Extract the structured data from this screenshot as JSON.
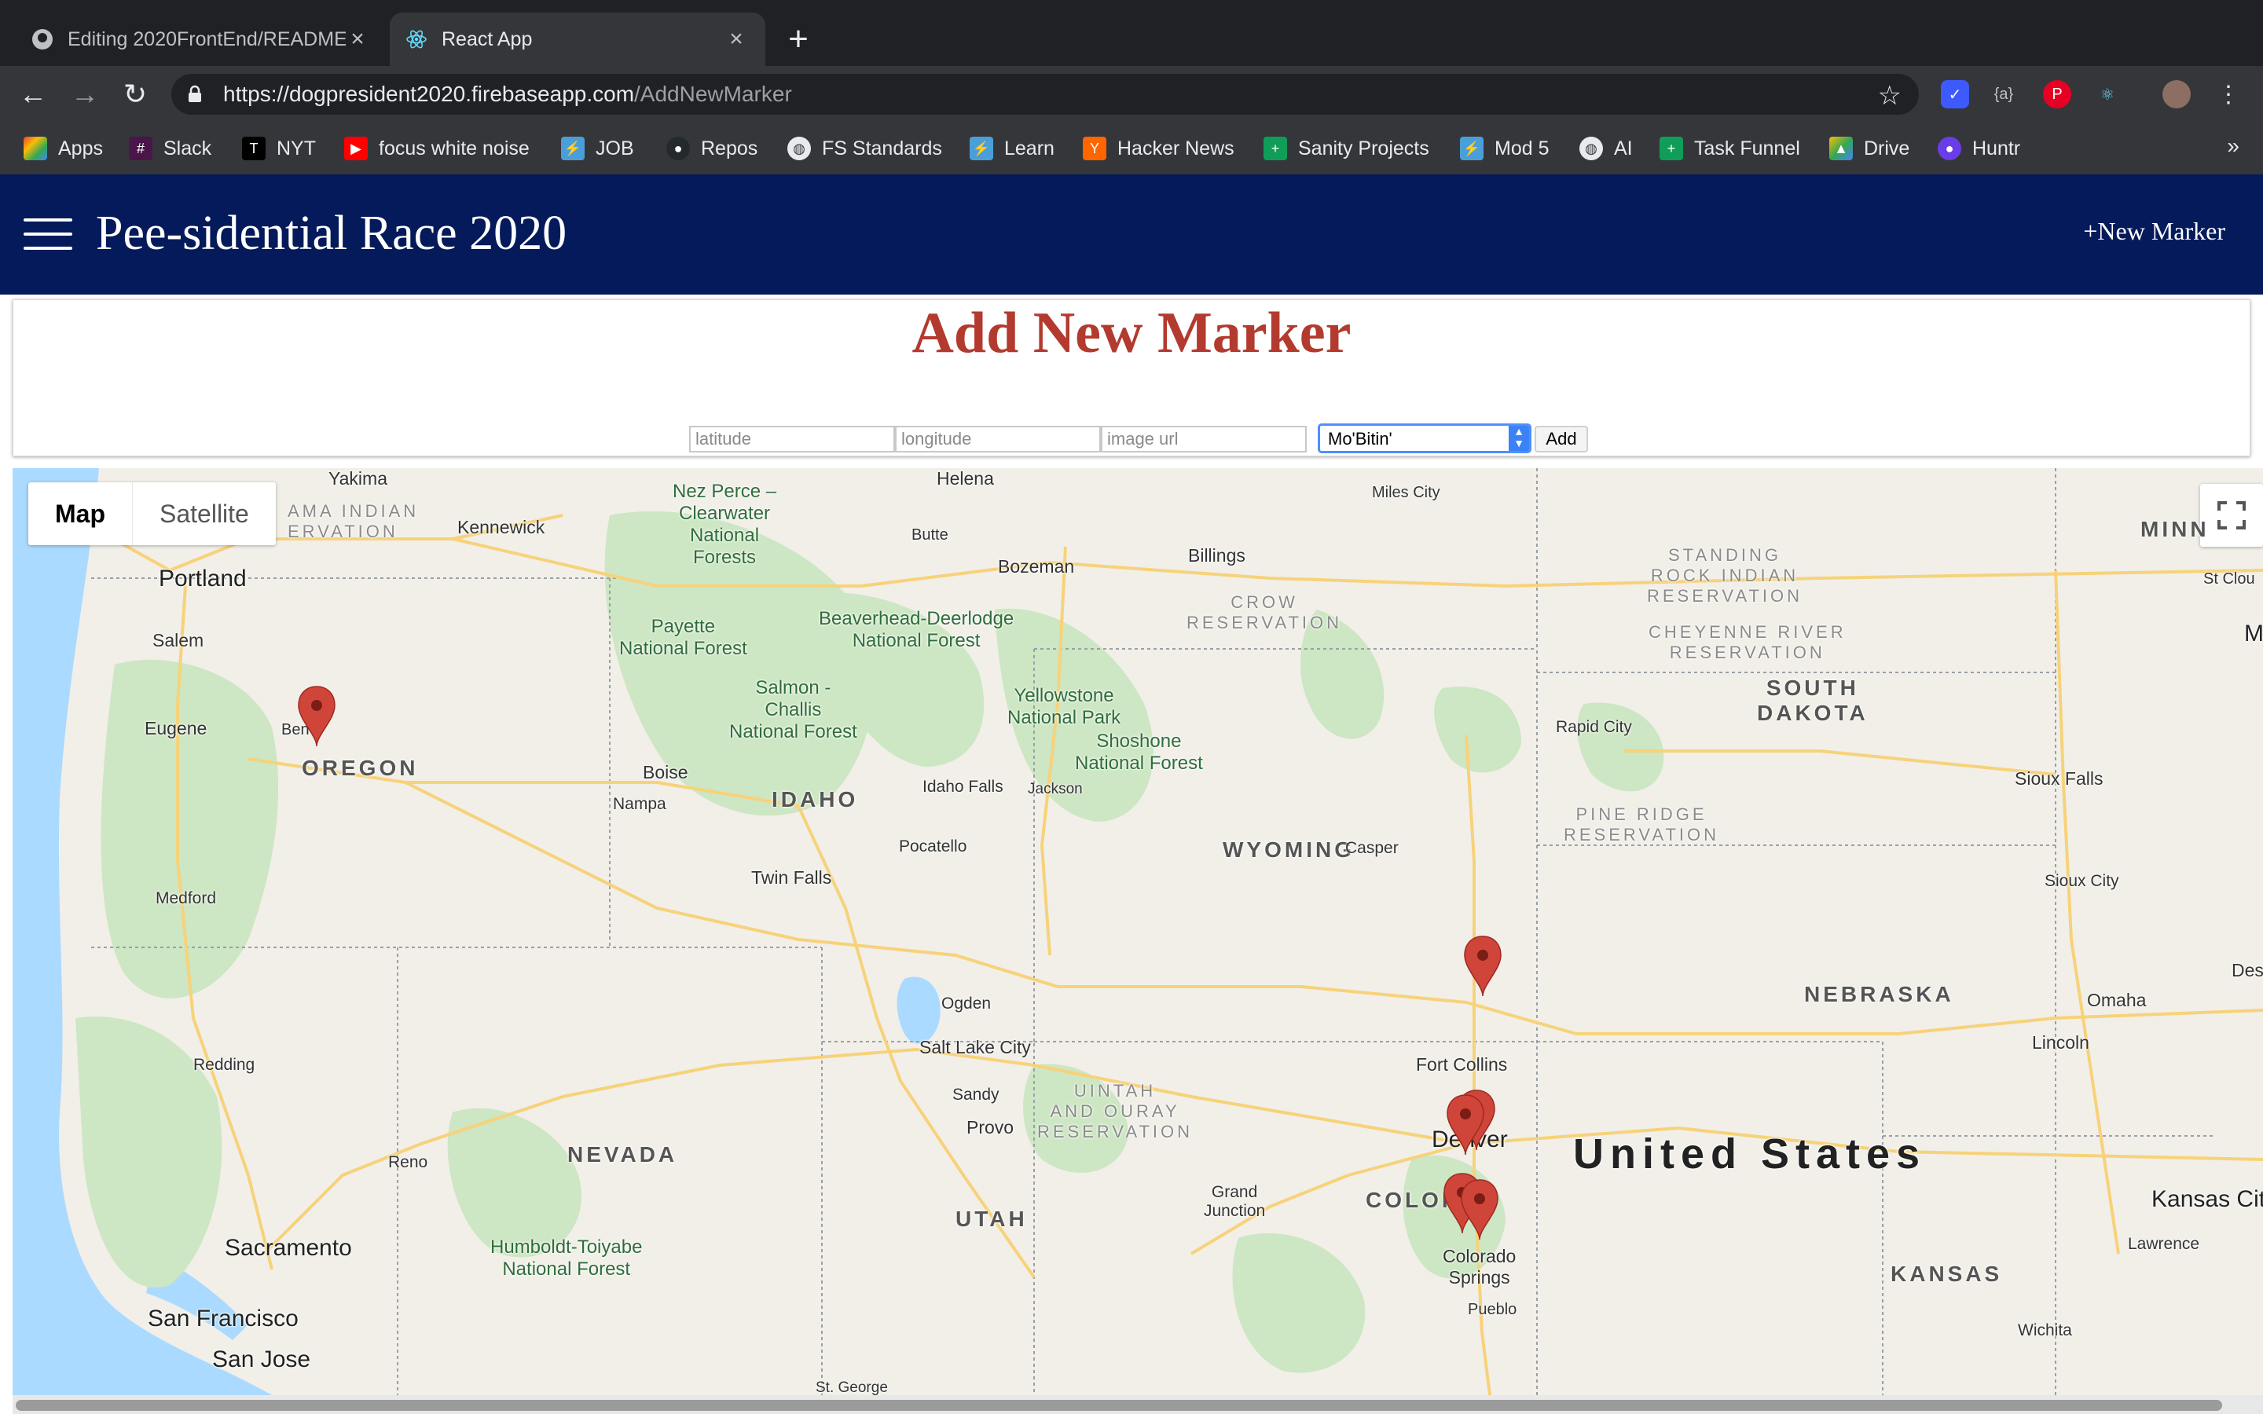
{
  "browser": {
    "tabs": [
      {
        "label": "Editing 2020FrontEnd/README",
        "icon": "github-icon",
        "active": false
      },
      {
        "label": "React App",
        "icon": "react-icon",
        "active": true
      }
    ],
    "new_tab_label": "+",
    "url_host": "https://dogpresident2020.firebaseapp.com",
    "url_path": "/AddNewMarker",
    "bookmarks": [
      {
        "label": "Apps",
        "icon": "apps-grid-icon",
        "color": "#ea4335"
      },
      {
        "label": "Slack",
        "icon": "slack-icon",
        "color": "#4a154b"
      },
      {
        "label": "NYT",
        "icon": "nyt-icon",
        "color": "#000000"
      },
      {
        "label": "focus white noise",
        "icon": "youtube-icon",
        "color": "#ff0000"
      },
      {
        "label": "JOB",
        "icon": "bolt-icon",
        "color": "#4a9fd8"
      },
      {
        "label": "Repos",
        "icon": "github-icon",
        "color": "#000000"
      },
      {
        "label": "FS Standards",
        "icon": "globe-icon",
        "color": "#ffffff"
      },
      {
        "label": "Learn",
        "icon": "bolt-icon",
        "color": "#4a9fd8"
      },
      {
        "label": "Hacker News",
        "icon": "y-icon",
        "color": "#ff6600"
      },
      {
        "label": "Sanity Projects",
        "icon": "sheets-icon",
        "color": "#0f9d58"
      },
      {
        "label": "Mod 5",
        "icon": "bolt-icon",
        "color": "#4a9fd8"
      },
      {
        "label": "AI",
        "icon": "globe-icon",
        "color": "#ffffff"
      },
      {
        "label": "Task Funnel",
        "icon": "sheets-icon",
        "color": "#0f9d58"
      },
      {
        "label": "Drive",
        "icon": "drive-icon",
        "color": "#fbbc04"
      },
      {
        "label": "Huntr",
        "icon": "huntr-icon",
        "color": "#6a3de8"
      }
    ],
    "bookmarks_more": "»"
  },
  "app": {
    "title": "Pee-sidential Race 2020",
    "new_marker_link": "+New Marker",
    "brand_color": "#041a5a"
  },
  "form": {
    "heading": "Add New Marker",
    "heading_color": "#b33a2e",
    "latitude_placeholder": "latitude",
    "longitude_placeholder": "longitude",
    "image_url_placeholder": "image url",
    "selected_option": "Mo'Bitin'",
    "add_label": "Add"
  },
  "map": {
    "type_controls": [
      "Map",
      "Satellite"
    ],
    "selected_type": "Map",
    "labels": {
      "yakima": "Yakima",
      "reservation_yakama": "AMA INDIAN\nERVATION",
      "kennewick": "Kennewick",
      "nez_perce": "Nez Perce –\nClearwater\nNational\nForests",
      "helena": "Helena",
      "miles_city": "Miles City",
      "minn": "MINN",
      "portland": "Portland",
      "butte": "Butte",
      "bozeman": "Bozeman",
      "billings": "Billings",
      "standing_rock": "STANDING\nROCK INDIAN\nRESERVATION",
      "st_cloud": "St Clou",
      "salem": "Salem",
      "payette": "Payette\nNational Forest",
      "beaverhead": "Beaverhead-Deerlodge\nNational Forest",
      "crow": "CROW\nRESERVATION",
      "cheyenne_river": "CHEYENNE RIVER\nRESERVATION",
      "m_edge": "M",
      "salmon_challis": "Salmon -\nChallis\nNational Forest",
      "yellowstone": "Yellowstone\nNational Park",
      "south_dakota": "SOUTH\nDAKOTA",
      "eugene": "Eugene",
      "bend": "Ben",
      "oregon": "OREGON",
      "rapid_city": "Rapid City",
      "shoshone": "Shoshone\nNational Forest",
      "boise": "Boise",
      "nampa": "Nampa",
      "idaho": "IDAHO",
      "idaho_falls": "Idaho Falls",
      "jackson": "Jackson",
      "sioux_falls": "Sioux Falls",
      "pine_ridge": "PINE RIDGE\nRESERVATION",
      "wyoming": "WYOMING",
      "casper": "Casper",
      "pocatello": "Pocatello",
      "twin_falls": "Twin Falls",
      "sioux_city": "Sioux City",
      "medford": "Medford",
      "des": "Des",
      "nebraska": "NEBRASKA",
      "omaha": "Omaha",
      "ogden": "Ogden",
      "salt_lake_city": "Salt Lake City",
      "lincoln": "Lincoln",
      "redding": "Redding",
      "fort_collins": "Fort Collins",
      "uintah": "UINTAH\nAND OURAY\nRESERVATION",
      "sandy": "Sandy",
      "provo": "Provo",
      "denver": "Denver",
      "nevada": "NEVADA",
      "reno": "Reno",
      "united_states": "United States",
      "grand_junction": "Grand\nJunction",
      "colorado": "COLOR",
      "kansas_city": "Kansas Cit",
      "utah": "UTAH",
      "sacramento": "Sacramento",
      "humboldt": "Humboldt-Toiyabe\nNational Forest",
      "colorado_springs": "Colorado\nSprings",
      "lawrence": "Lawrence",
      "kansas": "KANSAS",
      "pueblo": "Pueblo",
      "san_francisco": "San Francisco",
      "wichita": "Wichita",
      "san_jose": "San Jose",
      "st_george": "St. George"
    },
    "marker_color": "#d0453a",
    "water_color": "#aadaff",
    "forest_color": "#cde6c3",
    "road_color": "#f7d27a"
  }
}
